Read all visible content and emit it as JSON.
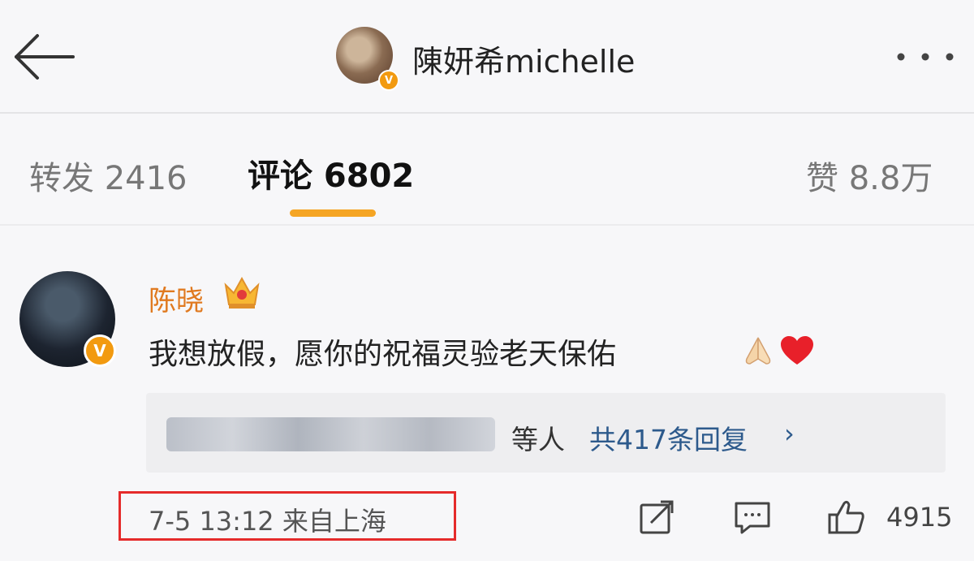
{
  "header": {
    "title": "陳妍希michelle",
    "back_icon": "arrow-left-icon",
    "more_icon": "more-horizontal-icon",
    "verified_badge": "V"
  },
  "tabs": [
    {
      "label": "转发 2416"
    },
    {
      "label": "评论 6802",
      "active": true
    },
    {
      "label": "赞 8.8万"
    }
  ],
  "accent_color": "#f5a524",
  "comment": {
    "author": "陈晓",
    "verified_badge": "V",
    "text": "我想放假，愿你的祝福灵验老天保佑",
    "emojis": [
      "praying-hands-icon",
      "heart-icon"
    ],
    "replies": {
      "prefix": "等人",
      "count_text": "共417条回复",
      "chevron": "›"
    },
    "meta": "7-5 13:12 来自上海",
    "likes": "4915"
  }
}
